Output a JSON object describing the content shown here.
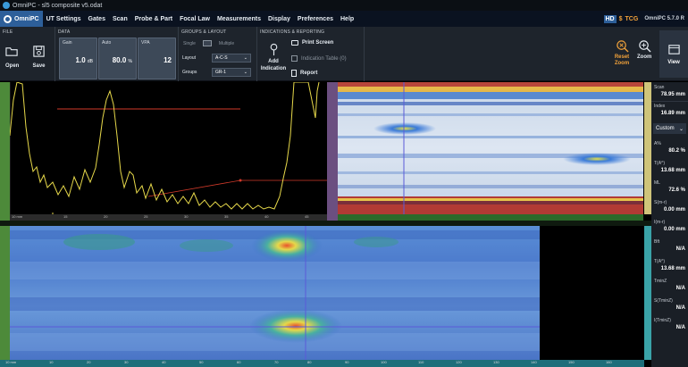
{
  "titlebar": {
    "text": "OmniPC - sl5 composite v5.odat"
  },
  "menu": {
    "brand": "OmniPC",
    "items": [
      "UT Settings",
      "Gates",
      "Scan",
      "Probe & Part",
      "Focal Law",
      "Measurements",
      "Display",
      "Preferences",
      "Help"
    ],
    "hd": "HD",
    "tcg": "TCG",
    "version": "OmniPC 5.7.0 R"
  },
  "ribbon": {
    "file": {
      "title": "FILE",
      "open": "Open",
      "save": "Save"
    },
    "data": {
      "title": "DATA",
      "gain": {
        "label": "Gain",
        "value": "1.0",
        "unit": "dB"
      },
      "auto": {
        "label": "Auto",
        "value": "80.0",
        "unit": "%"
      },
      "vpa": {
        "label": "VPA",
        "value": "12"
      }
    },
    "groups": {
      "title": "GROUPS & LAYOUT",
      "single": "Single",
      "multiple": "Multiple",
      "layout_label": "Layout",
      "layout_value": "A-C-S",
      "groups_label": "Groups",
      "groups_value": "GR-1"
    },
    "indications": {
      "title": "INDICATIONS & REPORTING",
      "add": "Add Indication",
      "print": "Print Screen",
      "table": "Indication Table (0)",
      "report": "Report"
    },
    "zoom": {
      "reset": "Reset Zoom",
      "zoom": "Zoom"
    },
    "view": "View"
  },
  "ascan_ruler": [
    "10 mm",
    "15",
    "20",
    "25",
    "30",
    "35",
    "40",
    "45"
  ],
  "cscan_ruler": [
    "10 mm",
    "10",
    "20",
    "30",
    "40",
    "50",
    "60",
    "70",
    "80",
    "90",
    "100",
    "110",
    "120",
    "130",
    "140",
    "150",
    "160"
  ],
  "readouts": {
    "scan": {
      "label": "Scan",
      "value": "78.95 mm"
    },
    "index": {
      "label": "Index",
      "value": "16.89 mm"
    },
    "custom": "Custom",
    "items": [
      {
        "label": "A%",
        "value": "80.2 %"
      },
      {
        "label": "T(A^)",
        "value": "13.68 mm"
      },
      {
        "label": "ML",
        "value": "72.6 %"
      },
      {
        "label": "S(m-r)",
        "value": "0.00 mm"
      },
      {
        "label": "I(m-r)",
        "value": "0.00 mm"
      },
      {
        "label": "Bft",
        "value": "N/A"
      },
      {
        "label": "T(A^)",
        "value": "13.68 mm"
      },
      {
        "label": "TminZ",
        "value": "N/A"
      },
      {
        "label": "S(TminZ)",
        "value": "N/A"
      },
      {
        "label": "I(TminZ)",
        "value": "N/A"
      }
    ]
  }
}
